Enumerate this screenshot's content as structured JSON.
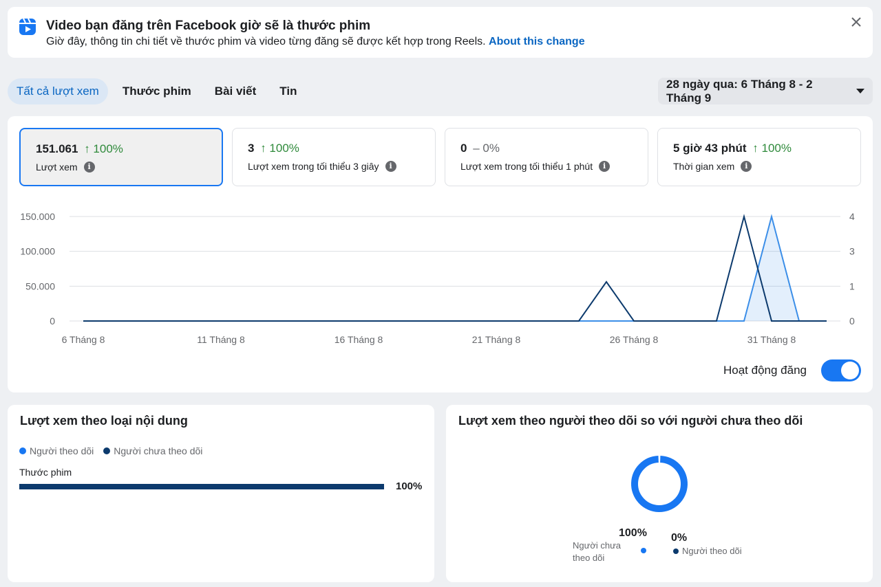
{
  "banner": {
    "icon": "reels-icon",
    "title": "Video bạn đăng trên Facebook giờ sẽ là thước phim",
    "description": "Giờ đây, thông tin chi tiết về thước phim và video từng đăng sẽ được kết hợp trong Reels.",
    "link": "About this change",
    "close_icon": "close-icon"
  },
  "tabs": [
    {
      "label": "Tất cả lượt xem",
      "active": true
    },
    {
      "label": "Thước phim",
      "active": false
    },
    {
      "label": "Bài viết",
      "active": false
    },
    {
      "label": "Tin",
      "active": false
    }
  ],
  "date_range": "28 ngày qua: 6 Tháng 8 - 2 Tháng 9",
  "metrics": [
    {
      "value": "151.061",
      "delta": "↑ 100%",
      "label": "Lượt xem",
      "selected": true
    },
    {
      "value": "3",
      "delta": "↑ 100%",
      "label": "Lượt xem trong tối thiểu 3 giây",
      "selected": false
    },
    {
      "value": "0",
      "delta": "– 0%",
      "label": "Lượt xem trong tối thiểu 1 phút",
      "selected": false
    },
    {
      "value": "5 giờ 43 phút",
      "delta": "↑ 100%",
      "label": "Thời gian xem",
      "selected": false
    }
  ],
  "toggle": {
    "label": "Hoạt động đăng",
    "on": true
  },
  "colors": {
    "accent": "#1877f2",
    "link": "#0a66c2",
    "dark_series": "#0c3a6d",
    "light_series": "#3b8ee8",
    "up": "#2f8a3b"
  },
  "chart_data": {
    "type": "line",
    "days": [
      "6 Tháng 8",
      "7 Tháng 8",
      "8 Tháng 8",
      "9 Tháng 8",
      "10 Tháng 8",
      "11 Tháng 8",
      "12 Tháng 8",
      "13 Tháng 8",
      "14 Tháng 8",
      "15 Tháng 8",
      "16 Tháng 8",
      "17 Tháng 8",
      "18 Tháng 8",
      "19 Tháng 8",
      "20 Tháng 8",
      "21 Tháng 8",
      "22 Tháng 8",
      "23 Tháng 8",
      "24 Tháng 8",
      "25 Tháng 8",
      "26 Tháng 8",
      "27 Tháng 8",
      "28 Tháng 8",
      "29 Tháng 8",
      "30 Tháng 8",
      "31 Tháng 8",
      "1 Tháng 9",
      "2 Tháng 9"
    ],
    "x_tick_labels": [
      "6 Tháng 8",
      "11 Tháng 8",
      "16 Tháng 8",
      "21 Tháng 8",
      "26 Tháng 8",
      "31 Tháng 8"
    ],
    "x_tick_indices": [
      0,
      5,
      10,
      15,
      20,
      25
    ],
    "y_left_ticks": [
      "0",
      "50.000",
      "100.000",
      "150.000"
    ],
    "y_left_range": [
      0,
      150000
    ],
    "y_right_ticks": [
      "0",
      "1",
      "3",
      "4"
    ],
    "y_right_range": [
      0,
      4
    ],
    "series": [
      {
        "axis": "left",
        "color": "#3b8ee8",
        "fill": true,
        "values": [
          0,
          0,
          0,
          0,
          0,
          0,
          0,
          0,
          0,
          0,
          0,
          0,
          0,
          0,
          0,
          0,
          0,
          0,
          0,
          0,
          0,
          0,
          0,
          0,
          0,
          151061,
          0,
          0
        ]
      },
      {
        "axis": "right",
        "color": "#0c3a6d",
        "fill": false,
        "values": [
          0,
          0,
          0,
          0,
          0,
          0,
          0,
          0,
          0,
          0,
          0,
          0,
          0,
          0,
          0,
          0,
          0,
          0,
          0,
          1.5,
          0,
          0,
          0,
          0,
          4,
          0,
          0,
          0
        ]
      }
    ]
  },
  "content_type_card": {
    "title": "Lượt xem theo loại nội dung",
    "legend": [
      {
        "label": "Người theo dõi",
        "color": "#1877f2"
      },
      {
        "label": "Người chưa theo dõi",
        "color": "#0c3a6d"
      }
    ],
    "bars": [
      {
        "label": "Thước phim",
        "percent": 100,
        "percent_label": "100%"
      }
    ]
  },
  "followers_card": {
    "title": "Lượt xem theo người theo dõi so với người chưa theo dõi",
    "non_followers": {
      "percent": 100,
      "percent_label": "100%",
      "label_line1": "Người chưa",
      "label_line2": "theo dõi",
      "color": "#1877f2"
    },
    "followers": {
      "percent": 0,
      "percent_label": "0%",
      "label": "Người theo dõi",
      "color": "#0c3a6d"
    }
  }
}
